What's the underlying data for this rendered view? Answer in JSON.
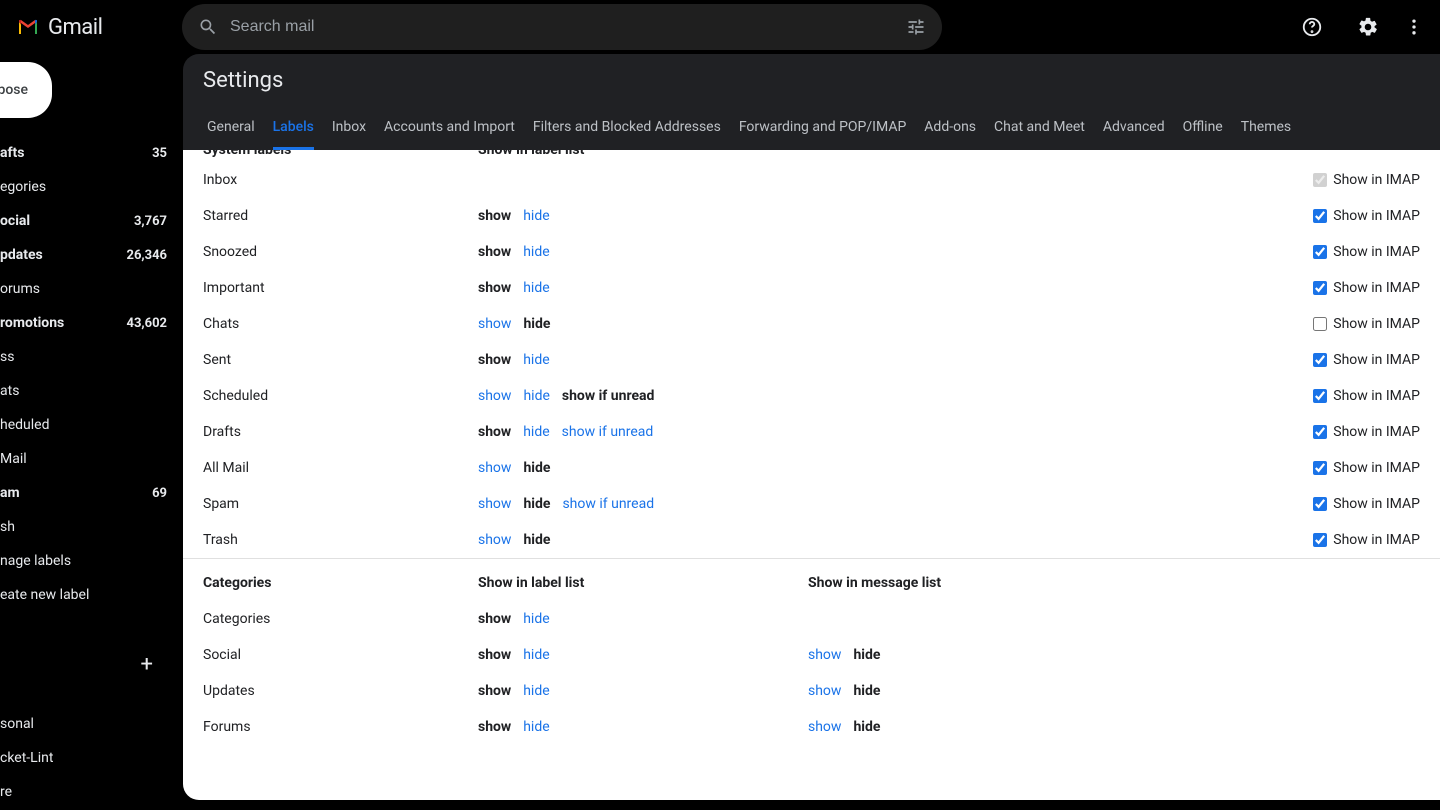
{
  "brand": "Gmail",
  "search": {
    "placeholder": "Search mail"
  },
  "compose_label": "mpose",
  "sidebar": {
    "items": [
      {
        "label": "afts",
        "count": "35",
        "bold": true
      },
      {
        "label": "egories",
        "count": "",
        "bold": false
      },
      {
        "label": "ocial",
        "count": "3,767",
        "bold": true
      },
      {
        "label": "pdates",
        "count": "26,346",
        "bold": true
      },
      {
        "label": "orums",
        "count": "",
        "bold": false
      },
      {
        "label": "romotions",
        "count": "43,602",
        "bold": true
      },
      {
        "label": "ss",
        "count": "",
        "bold": false
      },
      {
        "label": "ats",
        "count": "",
        "bold": false
      },
      {
        "label": "heduled",
        "count": "",
        "bold": false
      },
      {
        "label": "Mail",
        "count": "",
        "bold": false
      },
      {
        "label": "am",
        "count": "69",
        "bold": true
      },
      {
        "label": "sh",
        "count": "",
        "bold": false
      },
      {
        "label": "nage labels",
        "count": "",
        "bold": false
      },
      {
        "label": "eate new label",
        "count": "",
        "bold": false
      }
    ],
    "custom": [
      {
        "label": "sonal"
      },
      {
        "label": "cket-Lint"
      },
      {
        "label": "re"
      }
    ]
  },
  "settings": {
    "title": "Settings",
    "tabs": [
      "General",
      "Labels",
      "Inbox",
      "Accounts and Import",
      "Filters and Blocked Addresses",
      "Forwarding and POP/IMAP",
      "Add-ons",
      "Chat and Meet",
      "Advanced",
      "Offline",
      "Themes"
    ],
    "active_tab": "Labels",
    "system_section": {
      "header_col1": "System labels",
      "header_col2": "Show in label list",
      "rows": [
        {
          "name": "Inbox",
          "opts": [],
          "imap_checked": true,
          "imap_disabled": true
        },
        {
          "name": "Starred",
          "opts": [
            {
              "t": "show",
              "b": true
            },
            {
              "t": "hide",
              "l": true
            }
          ],
          "imap_checked": true
        },
        {
          "name": "Snoozed",
          "opts": [
            {
              "t": "show",
              "b": true
            },
            {
              "t": "hide",
              "l": true
            }
          ],
          "imap_checked": true
        },
        {
          "name": "Important",
          "opts": [
            {
              "t": "show",
              "b": true
            },
            {
              "t": "hide",
              "l": true
            }
          ],
          "imap_checked": true
        },
        {
          "name": "Chats",
          "opts": [
            {
              "t": "show",
              "l": true
            },
            {
              "t": "hide",
              "b": true
            }
          ],
          "imap_checked": false
        },
        {
          "name": "Sent",
          "opts": [
            {
              "t": "show",
              "b": true
            },
            {
              "t": "hide",
              "l": true
            }
          ],
          "imap_checked": true
        },
        {
          "name": "Scheduled",
          "opts": [
            {
              "t": "show",
              "l": true
            },
            {
              "t": "hide",
              "l": true
            },
            {
              "t": "show if unread",
              "b": true
            }
          ],
          "imap_checked": true
        },
        {
          "name": "Drafts",
          "opts": [
            {
              "t": "show",
              "b": true
            },
            {
              "t": "hide",
              "l": true
            },
            {
              "t": "show if unread",
              "l": true
            }
          ],
          "imap_checked": true
        },
        {
          "name": "All Mail",
          "opts": [
            {
              "t": "show",
              "l": true
            },
            {
              "t": "hide",
              "b": true
            }
          ],
          "imap_checked": true
        },
        {
          "name": "Spam",
          "opts": [
            {
              "t": "show",
              "l": true
            },
            {
              "t": "hide",
              "b": true
            },
            {
              "t": "show if unread",
              "l": true
            }
          ],
          "imap_checked": true
        },
        {
          "name": "Trash",
          "opts": [
            {
              "t": "show",
              "l": true
            },
            {
              "t": "hide",
              "b": true
            }
          ],
          "imap_checked": true
        }
      ]
    },
    "categories_section": {
      "header_col1": "Categories",
      "header_col2": "Show in label list",
      "header_col3": "Show in message list",
      "rows": [
        {
          "name": "Categories",
          "opts": [
            {
              "t": "show",
              "b": true
            },
            {
              "t": "hide",
              "l": true
            }
          ],
          "msg": []
        },
        {
          "name": "Social",
          "opts": [
            {
              "t": "show",
              "b": true
            },
            {
              "t": "hide",
              "l": true
            }
          ],
          "msg": [
            {
              "t": "show",
              "l": true
            },
            {
              "t": "hide",
              "b": true
            }
          ]
        },
        {
          "name": "Updates",
          "opts": [
            {
              "t": "show",
              "b": true
            },
            {
              "t": "hide",
              "l": true
            }
          ],
          "msg": [
            {
              "t": "show",
              "l": true
            },
            {
              "t": "hide",
              "b": true
            }
          ]
        },
        {
          "name": "Forums",
          "opts": [
            {
              "t": "show",
              "b": true
            },
            {
              "t": "hide",
              "l": true
            }
          ],
          "msg": [
            {
              "t": "show",
              "l": true
            },
            {
              "t": "hide",
              "b": true
            }
          ]
        }
      ]
    },
    "imap_label": "Show in IMAP"
  }
}
